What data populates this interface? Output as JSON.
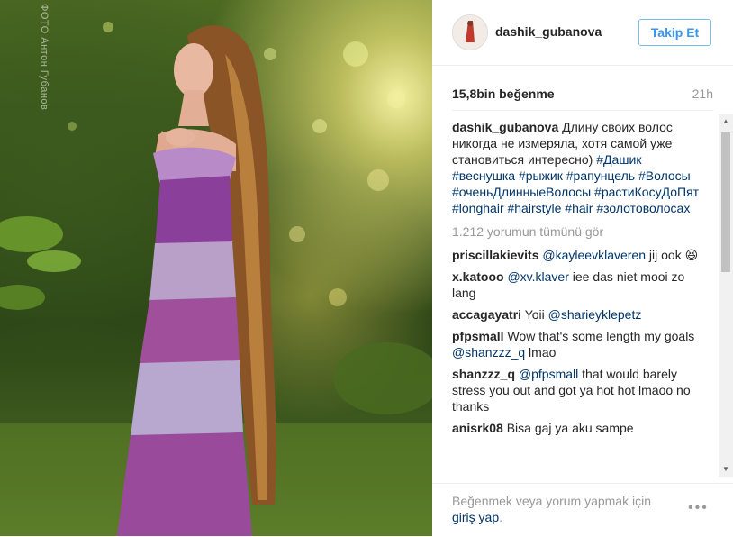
{
  "photo": {
    "watermark": "ФОТО Антон Губанов"
  },
  "post": {
    "username": "dashik_gubanova",
    "follow_label": "Takip Et",
    "likes": "15,8bin beğenme",
    "time": "21h"
  },
  "caption": {
    "username": "dashik_gubanova",
    "text": "Длину своих волос никогда не измеряла, хотя самой уже становиться интересно)",
    "hashtags": "#Дашик #веснушка #рыжик #рапунцель #Волосы #оченьДлинныеВолосы #растиКосуДоПят #longhair #hairstyle #hair #золотоволосах"
  },
  "view_all": "1.212 yorumun tümünü gör",
  "comments": [
    {
      "user": "priscillakievits",
      "mention": "@kayleevklaveren",
      "text": "jij ook 😆"
    },
    {
      "user": "x.katooo",
      "mention": "@xv.klaver",
      "text": "iee das niet mooi zo lang"
    },
    {
      "user": "accagayatri",
      "pre": "Yoii",
      "mention": "@sharieyklepetz",
      "text": ""
    },
    {
      "user": "pfpsmall",
      "pre": "Wow that's some length my goals",
      "mention": "@shanzzz_q",
      "text": "lmao"
    },
    {
      "user": "shanzzz_q",
      "mention": "@pfpsmall",
      "text": "that would barely stress you out and got ya hot hot lmaoo no thanks"
    },
    {
      "user": "anisrk08",
      "pre": "Bisa gaj ya aku sampe",
      "mention": "",
      "text": ""
    }
  ],
  "footer": {
    "login_text": "Beğenmek veya yorum yapmak için",
    "login_link": "giriş yap",
    "login_end": ".",
    "more_icon": "•••"
  }
}
